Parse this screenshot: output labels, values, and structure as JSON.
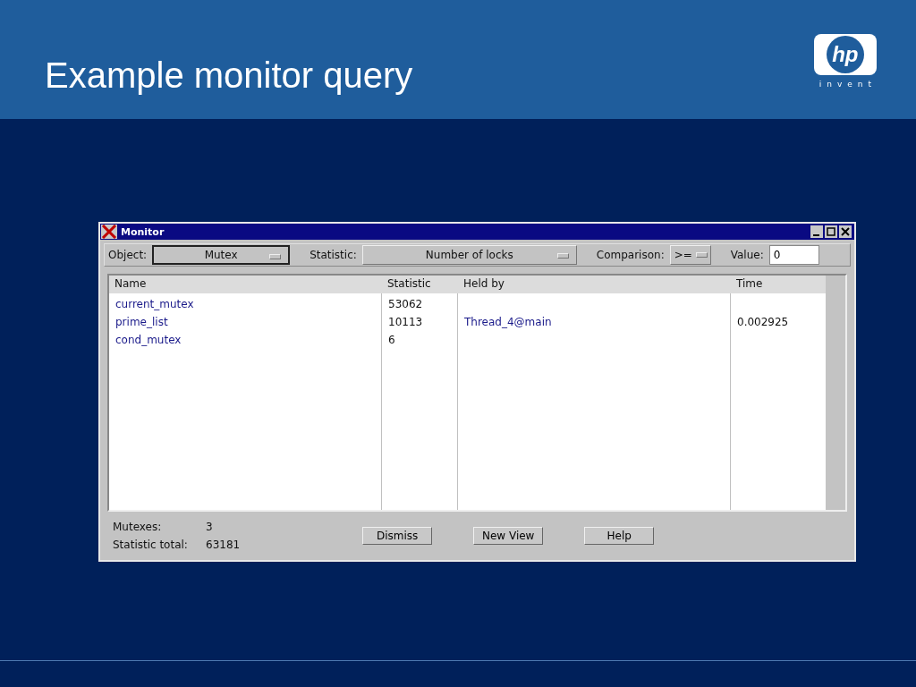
{
  "slide": {
    "title": "Example monitor query",
    "logo": {
      "mark": "hp",
      "tagline": "invent"
    }
  },
  "window": {
    "title": "Monitor",
    "toolbar": [
      {
        "kind": "short-select",
        "label": "Object:",
        "value": "Mutex"
      },
      {
        "kind": "long-select",
        "label": "Statistic:",
        "value": "Number of locks"
      },
      {
        "kind": "small-select",
        "label": "Comparison:",
        "value": ">="
      },
      {
        "kind": "input",
        "label": "Value:",
        "value": "0"
      }
    ],
    "table": {
      "columns": [
        "Name",
        "Statistic",
        "Held by",
        "Time"
      ],
      "rows": [
        [
          "current_mutex",
          "53062",
          "",
          ""
        ],
        [
          "prime_list",
          "10113",
          "Thread_4@main",
          "0.002925"
        ],
        [
          "cond_mutex",
          "6",
          "",
          ""
        ]
      ]
    },
    "summary": [
      {
        "label": "Mutexes:",
        "value": "3"
      },
      {
        "label": "Statistic total:",
        "value": "63181"
      }
    ],
    "buttons": [
      "Dismiss",
      "New View",
      "Help"
    ]
  }
}
